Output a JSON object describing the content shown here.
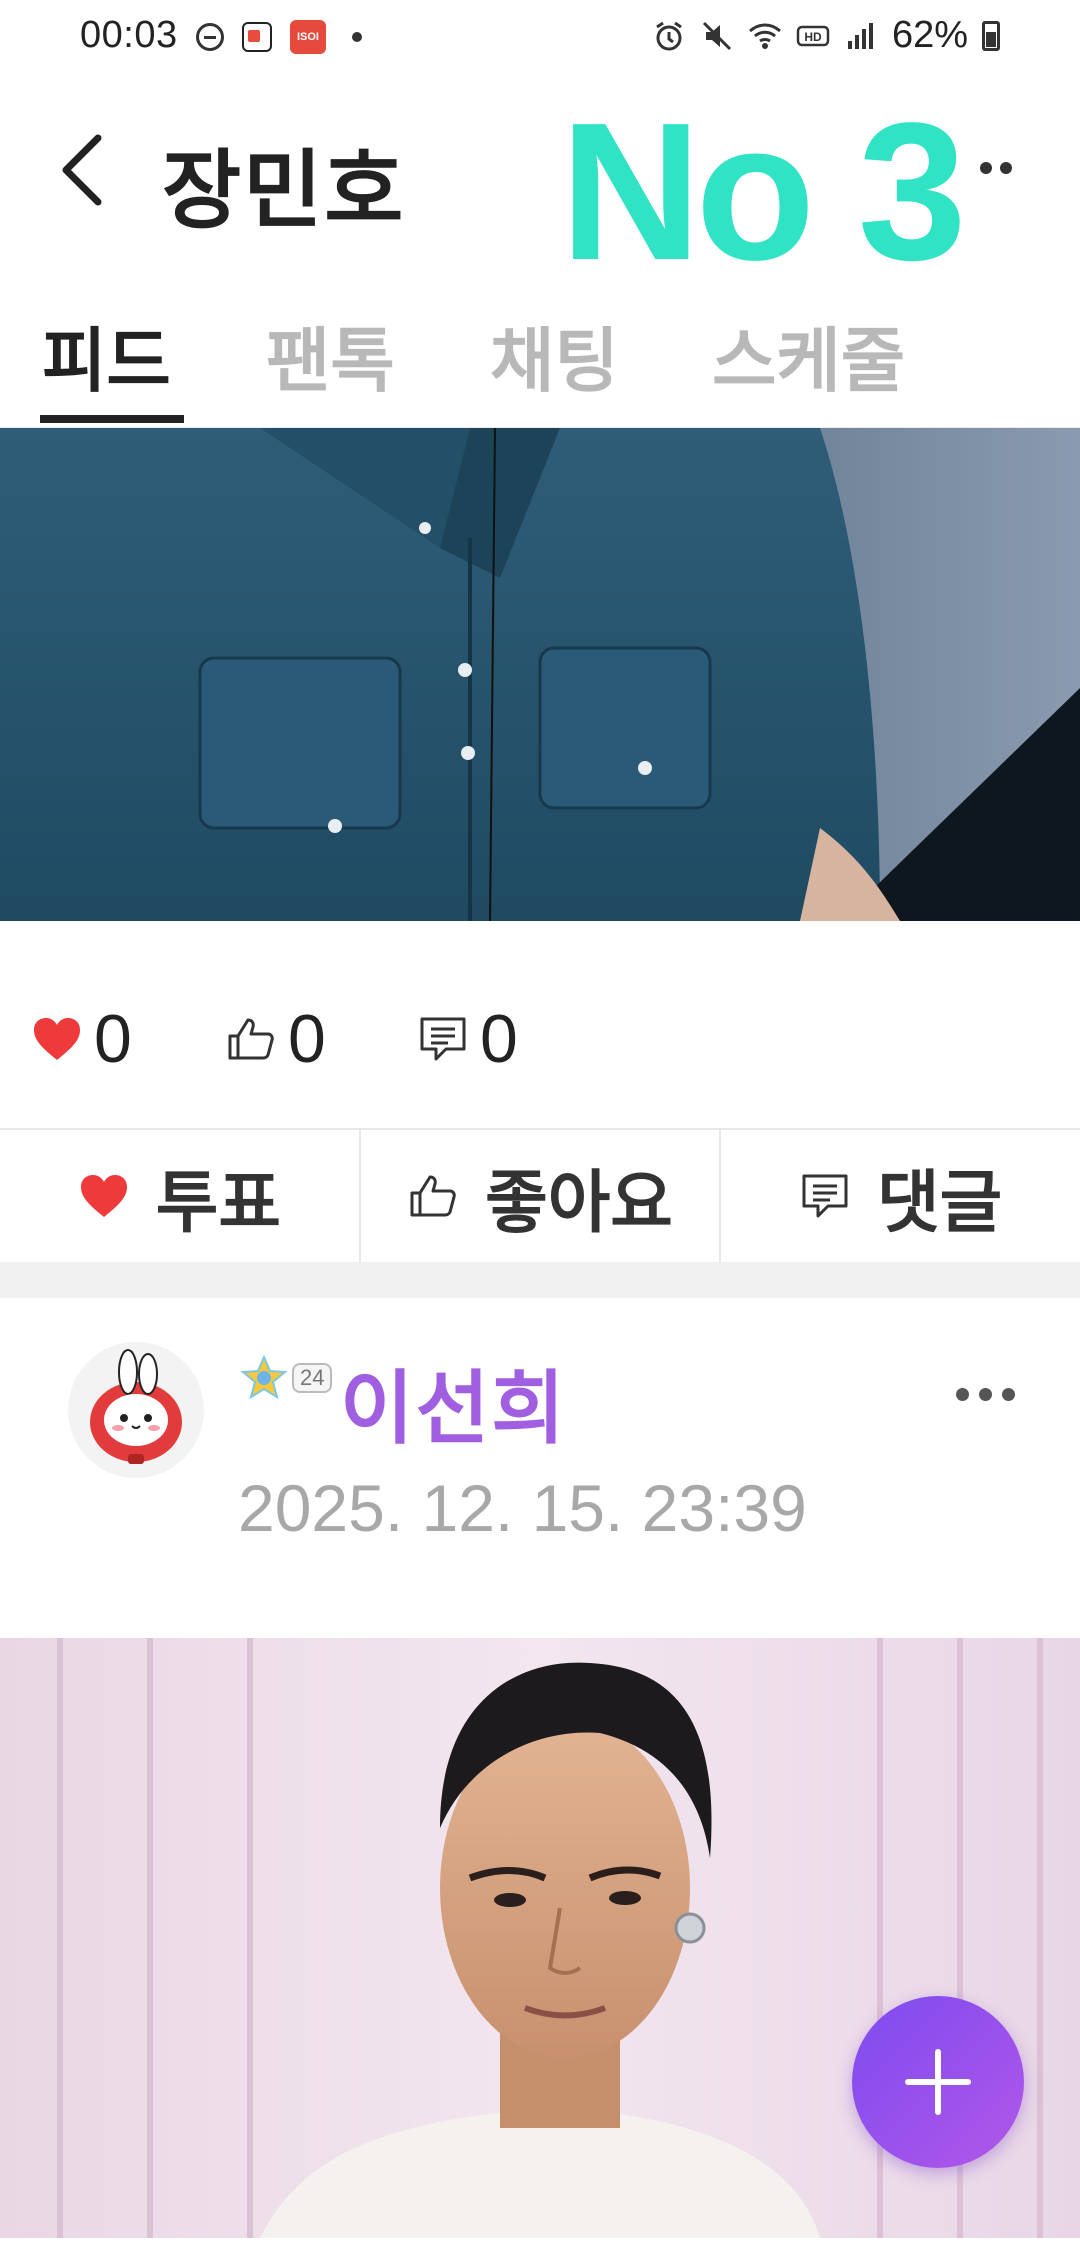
{
  "status_bar": {
    "time": "00:03",
    "battery": "62%",
    "app_badge": "ISOI"
  },
  "header": {
    "title": "장민호",
    "overlay_text": "No 3"
  },
  "tabs": [
    {
      "label": "피드",
      "active": true
    },
    {
      "label": "팬톡",
      "active": false
    },
    {
      "label": "채팅",
      "active": false
    },
    {
      "label": "스케줄",
      "active": false
    }
  ],
  "post_stats": {
    "votes": "0",
    "likes": "0",
    "comments": "0"
  },
  "actions": {
    "vote_label": "투표",
    "like_label": "좋아요",
    "comment_label": "댓글"
  },
  "next_post": {
    "author": "이선희",
    "level": "24",
    "date": "2025. 12. 15. 23:39"
  },
  "colors": {
    "accent_purple": "#a05fe0",
    "heart_red": "#ee3a3a",
    "overlay_teal": "#30e3c5",
    "fab_gradient": [
      "#7d4bf0",
      "#b257e8"
    ]
  }
}
